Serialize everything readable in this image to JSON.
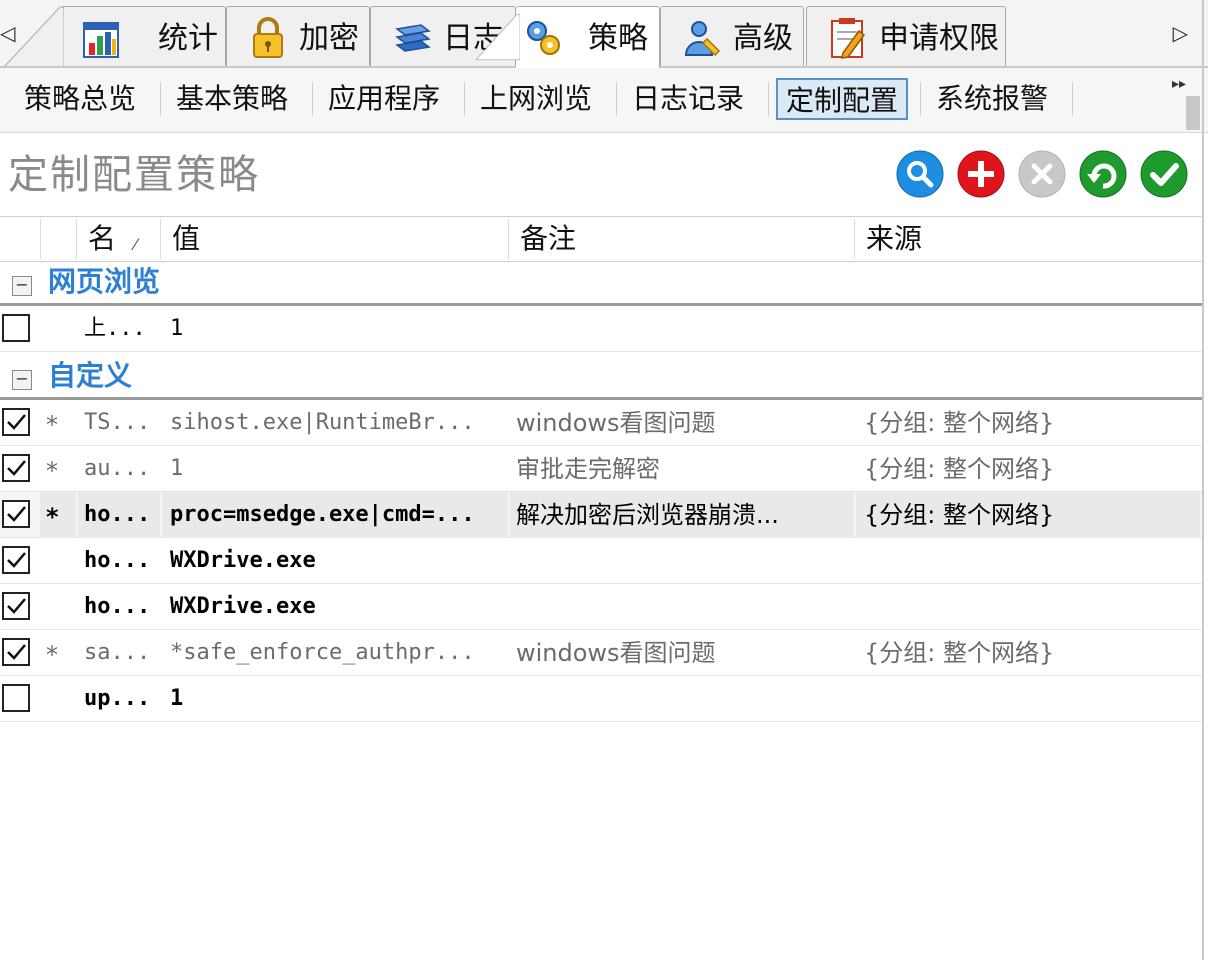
{
  "main_tabs": {
    "prev": "◁",
    "next": "▷",
    "items": [
      {
        "label": "统计",
        "icon": "bar-chart-icon"
      },
      {
        "label": "加密",
        "icon": "padlock-icon"
      },
      {
        "label": "日志",
        "icon": "log-books-icon"
      },
      {
        "label": "策略",
        "icon": "policy-gears-icon"
      },
      {
        "label": "高级",
        "icon": "user-tools-icon"
      },
      {
        "label": "申请权限",
        "icon": "notepad-pencil-icon"
      }
    ],
    "active": "策略"
  },
  "sub_tabs": {
    "items": [
      "策略总览",
      "基本策略",
      "应用程序",
      "上网浏览",
      "日志记录",
      "定制配置",
      "系统报警"
    ],
    "active": "定制配置",
    "overflow": "▸▸"
  },
  "page": {
    "title": "定制配置策略",
    "actions": [
      {
        "name": "search-button",
        "icon": "magnifier-icon",
        "color": "#1e8fe0"
      },
      {
        "name": "add-button",
        "icon": "plus-icon",
        "color": "#e0141c"
      },
      {
        "name": "delete-button",
        "icon": "cross-icon",
        "color": "#c8c8c8"
      },
      {
        "name": "undo-button",
        "icon": "undo-arrow-icon",
        "color": "#1f9a2c"
      },
      {
        "name": "apply-button",
        "icon": "checkmark-icon",
        "color": "#1f9a2c"
      }
    ]
  },
  "grid": {
    "columns": {
      "name": "名",
      "sort": "⁄",
      "value": "值",
      "note": "备注",
      "source": "来源"
    },
    "groups": [
      {
        "label": "网页浏览",
        "toggle": "−",
        "rows": [
          {
            "checked": false,
            "star": "",
            "name": "上...",
            "value": "1",
            "note": "",
            "source": "",
            "style": "normal"
          }
        ]
      },
      {
        "label": "自定义",
        "toggle": "−",
        "rows": [
          {
            "checked": true,
            "star": "*",
            "name": "TS...",
            "value": "sihost.exe|RuntimeBr...",
            "note": "windows看图问题",
            "source": "{分组: 整个网络}",
            "style": "dim"
          },
          {
            "checked": true,
            "star": "*",
            "name": "au...",
            "value": "1",
            "note": "审批走完解密",
            "source": "{分组: 整个网络}",
            "style": "dim"
          },
          {
            "checked": true,
            "star": "*",
            "name": "ho...",
            "value": "proc=msedge.exe|cmd=...",
            "note": "解决加密后浏览器崩溃...",
            "source": "{分组: 整个网络}",
            "style": "selected"
          },
          {
            "checked": true,
            "star": "",
            "name": "ho...",
            "value": "WXDrive.exe",
            "note": "",
            "source": "",
            "style": "normal"
          },
          {
            "checked": true,
            "star": "",
            "name": "ho...",
            "value": "WXDrive.exe",
            "note": "",
            "source": "",
            "style": "normal"
          },
          {
            "checked": true,
            "star": "*",
            "name": "sa...",
            "value": "*safe_enforce_authpr...",
            "note": "windows看图问题",
            "source": "{分组: 整个网络}",
            "style": "dim"
          },
          {
            "checked": false,
            "star": "",
            "name": "up...",
            "value": "1",
            "note": "",
            "source": "",
            "style": "normal"
          }
        ]
      }
    ]
  }
}
